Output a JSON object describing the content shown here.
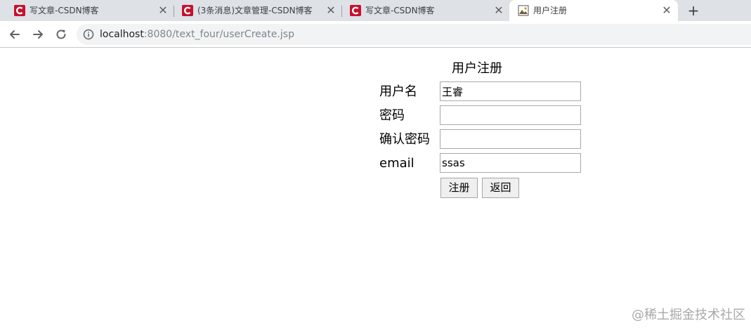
{
  "browser": {
    "tabs": [
      {
        "title": "写文章-CSDN博客",
        "icon": "csdn-logo-icon",
        "active": false
      },
      {
        "title": "(3条消息)文章管理-CSDN博客",
        "icon": "csdn-logo-icon",
        "active": false
      },
      {
        "title": "写文章-CSDN博客",
        "icon": "csdn-logo-icon",
        "active": false
      },
      {
        "title": "用户注册",
        "icon": "page-image-icon",
        "active": true
      }
    ],
    "url_host": "localhost",
    "url_rest": ":8080/text_four/userCreate.jsp",
    "accent_color": "#c8102e"
  },
  "form": {
    "title": "用户注册",
    "fields": [
      {
        "label": "用户名",
        "value": "王睿"
      },
      {
        "label": "密码",
        "value": ""
      },
      {
        "label": "确认密码",
        "value": ""
      },
      {
        "label": "email",
        "value": "ssas"
      }
    ],
    "submit_label": "注册",
    "back_label": "返回"
  },
  "watermark": "@稀土掘金技术社区"
}
